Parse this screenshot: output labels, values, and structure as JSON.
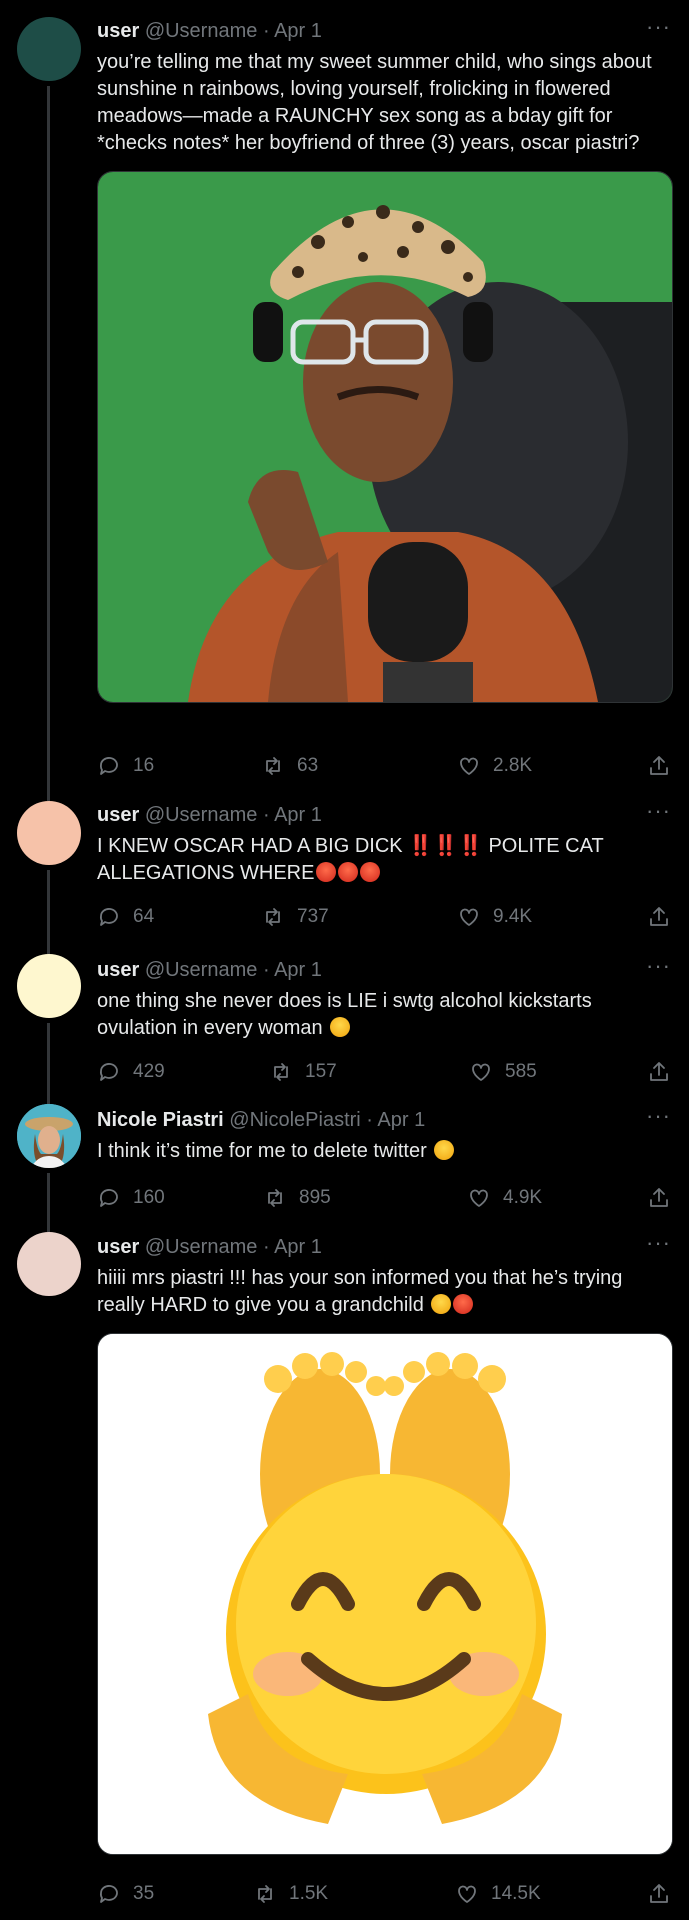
{
  "tweets": [
    {
      "name": "user",
      "handle": "@Username",
      "date": "Apr 1",
      "text": "you’re telling me that my sweet summer child, who sings about sunshine n rainbows, loving yourself, frolicking in flowered meadows—made a RAUNCHY sex song as a bday gift for *checks notes* her boyfriend of three (3) years, oscar piastri?",
      "avatar_color": "#1e4d47",
      "replies": "16",
      "retweets": "63",
      "likes": "2.8K"
    },
    {
      "name": "user",
      "handle": "@Username",
      "date": "Apr 1",
      "text_a": "I KNEW OSCAR HAD A BIG DICK ",
      "bangs": "‼️‼️‼️",
      "text_b": "POLITE CAT ALLEGATIONS WHERE",
      "avatar_color": "#f6c2a9",
      "replies": "64",
      "retweets": "737",
      "likes": "9.4K"
    },
    {
      "name": "user",
      "handle": "@Username",
      "date": "Apr 1",
      "text": "one thing she never does is LIE i swtg alcohol kickstarts ovulation in every woman",
      "avatar_color": "#fef7cf",
      "replies": "429",
      "retweets": "157",
      "likes": "585"
    },
    {
      "name": "Nicole Piastri",
      "handle": "@NicolePiastri",
      "date": "Apr 1",
      "text": "I think it’s time for me to delete twitter",
      "avatar_color": "#3aa0b5",
      "replies": "160",
      "retweets": "895",
      "likes": "4.9K"
    },
    {
      "name": "user",
      "handle": "@Username",
      "date": "Apr 1",
      "text": "hiiii mrs piastri !!! has your son informed you that he’s trying really HARD to give you a grandchild",
      "avatar_color": "#ecd3cb",
      "replies": "35",
      "retweets": "1.5K",
      "likes": "14.5K"
    }
  ],
  "colors": {
    "background": "#000000",
    "muted": "#71767b",
    "text": "#e7e9ea",
    "thread_line": "#333639"
  },
  "icons": [
    "reply-icon",
    "retweet-icon",
    "like-icon",
    "share-icon",
    "more-icon"
  ]
}
